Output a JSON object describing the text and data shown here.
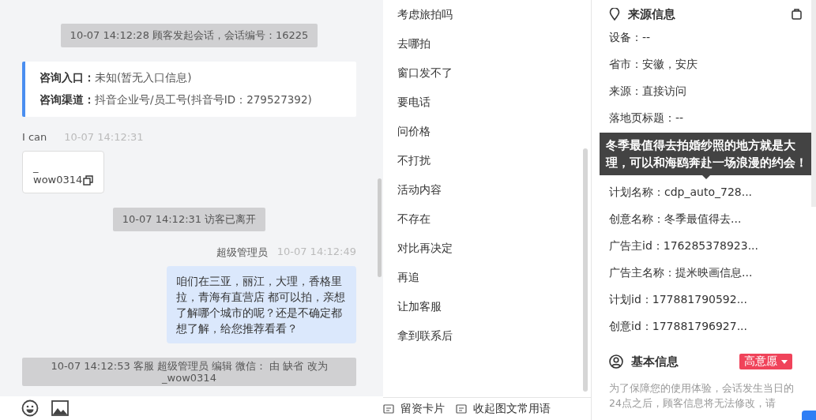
{
  "chat": {
    "messages": [
      {
        "kind": "system",
        "text": "10-07 14:12:28 顾客发起会话，会话编号：16225"
      },
      {
        "kind": "info",
        "rows": [
          {
            "label": "咨询入口：",
            "value": "未知(暂无入口信息)"
          },
          {
            "label": "咨询渠道：",
            "value": "抖音企业号/员工号(抖音号ID：279527392)"
          }
        ]
      },
      {
        "kind": "incoming",
        "sender": "I can",
        "time": "10-07 14:12:31",
        "card_lines": [
          "_",
          "wow0314"
        ]
      },
      {
        "kind": "system",
        "text": "10-07 14:12:31 访客已离开"
      },
      {
        "kind": "outgoing",
        "sender": "超级管理员",
        "time": "10-07 14:12:49",
        "text": "咱们在三亚，丽江，大理，香格里拉，青海有直营店 都可以拍，亲想了解哪个城市的呢？还是不确定都想了解，给您推荐看看？"
      },
      {
        "kind": "wide_system",
        "text": "10-07 14:12:53 客服 超级管理员 编辑 微信： 由 缺省 改为 _wow0314"
      }
    ]
  },
  "quick_replies": {
    "items": [
      "考虑旅拍吗",
      "去哪拍",
      "窗口发不了",
      "要电话",
      "问价格",
      "不打扰",
      "活动内容",
      "不存在",
      "对比再决定",
      "再追",
      "让加客服",
      "拿到联系后"
    ],
    "footer_buttons": [
      "留资卡片",
      "收起图文常用语"
    ]
  },
  "source_info": {
    "title": "来源信息",
    "rows_before_tooltip": [
      "设备：--",
      "省市：安徽，安庆",
      "来源：直接访问",
      "落地页标题：--"
    ],
    "tooltip": "冬季最值得去拍婚纱照的地方就是大理，可以和海鸥奔赴一场浪漫的约会！",
    "rows_after_tooltip": [
      "计划名称：cdp_auto_728...",
      "创意名称：冬季最值得去...",
      "广告主id：176285378923...",
      "广告主名称：提米映画信息...",
      "计划id：177881790592...",
      "创意id：177881796927..."
    ]
  },
  "basic_info": {
    "title": "基本信息",
    "intent_tag": "高意愿",
    "notice": "为了保障您的使用体验，会话发生当日的24点之后，顾客信息将无法修改，请"
  }
}
